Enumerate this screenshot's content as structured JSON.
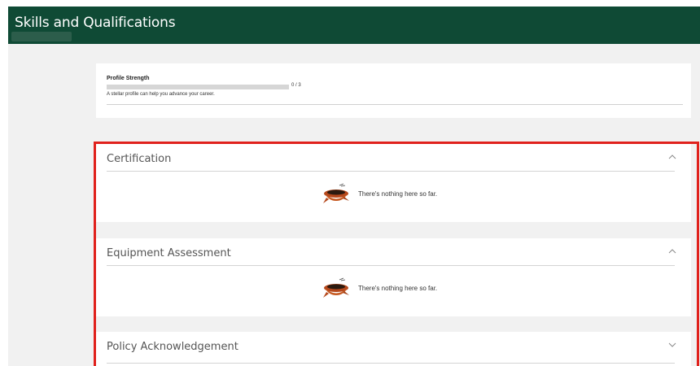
{
  "header": {
    "title": "Skills and Qualifications"
  },
  "profile": {
    "title": "Profile Strength",
    "progress_current": 0,
    "progress_total": 3,
    "progress_text": "0 / 3",
    "description": "A stellar profile can help you advance your career."
  },
  "sections": [
    {
      "title": "Certification",
      "expanded": true,
      "chevron": "chevron-up-icon",
      "empty_text": "There's nothing here so far."
    },
    {
      "title": "Equipment Assessment",
      "expanded": true,
      "chevron": "chevron-up-icon",
      "empty_text": "There's nothing here so far."
    },
    {
      "title": "Policy Acknowledgement",
      "expanded": false,
      "chevron": "chevron-down-icon"
    }
  ],
  "colors": {
    "header_bg": "#0f4a35",
    "highlight_border": "#e0211c",
    "content_bg": "#f1f1f1"
  }
}
